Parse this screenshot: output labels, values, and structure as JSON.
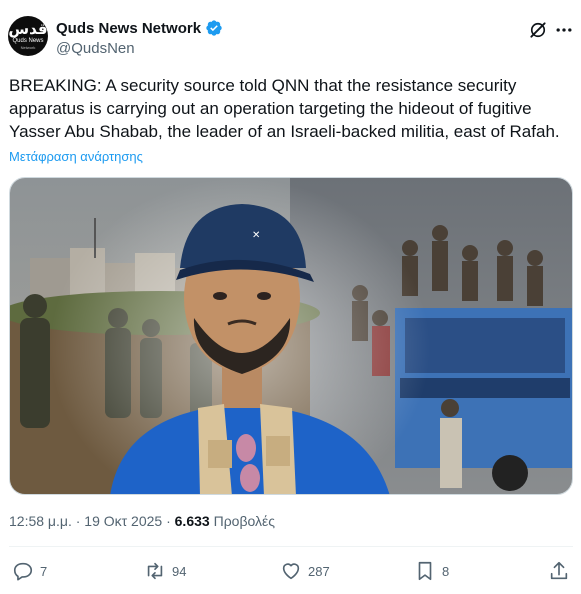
{
  "account": {
    "name": "Quds News Network",
    "handle": "@QudsNen",
    "avatar_text_ar": "قدس",
    "avatar_text_en": "Quds News",
    "avatar_text_sub": "Network",
    "verified_color": "#1d9bf0"
  },
  "header_icons": [
    "grok-icon",
    "more-icon"
  ],
  "post": {
    "text": "BREAKING: A security source told QNN that the resistance security apparatus is carrying out an operation targeting the hideout of fugitive Yasser Abu Shabab, the leader of an Israeli-backed militia, east of Rafah.",
    "translate_label": "Μετάφραση ανάρτησης"
  },
  "meta": {
    "time_date": "12:58 μ.μ. · 19 Οκτ 2025 · ",
    "views_count": "6.633",
    "views_label": " Προβολές"
  },
  "actions": {
    "replies": "7",
    "reposts": "94",
    "likes": "287",
    "bookmarks": "8"
  },
  "colors": {
    "text": "#0f1419",
    "secondary": "#536471",
    "link": "#1d9bf0",
    "cap": "#1f3a63",
    "shirt": "#1e63c8",
    "vest": "#d9c39a"
  }
}
